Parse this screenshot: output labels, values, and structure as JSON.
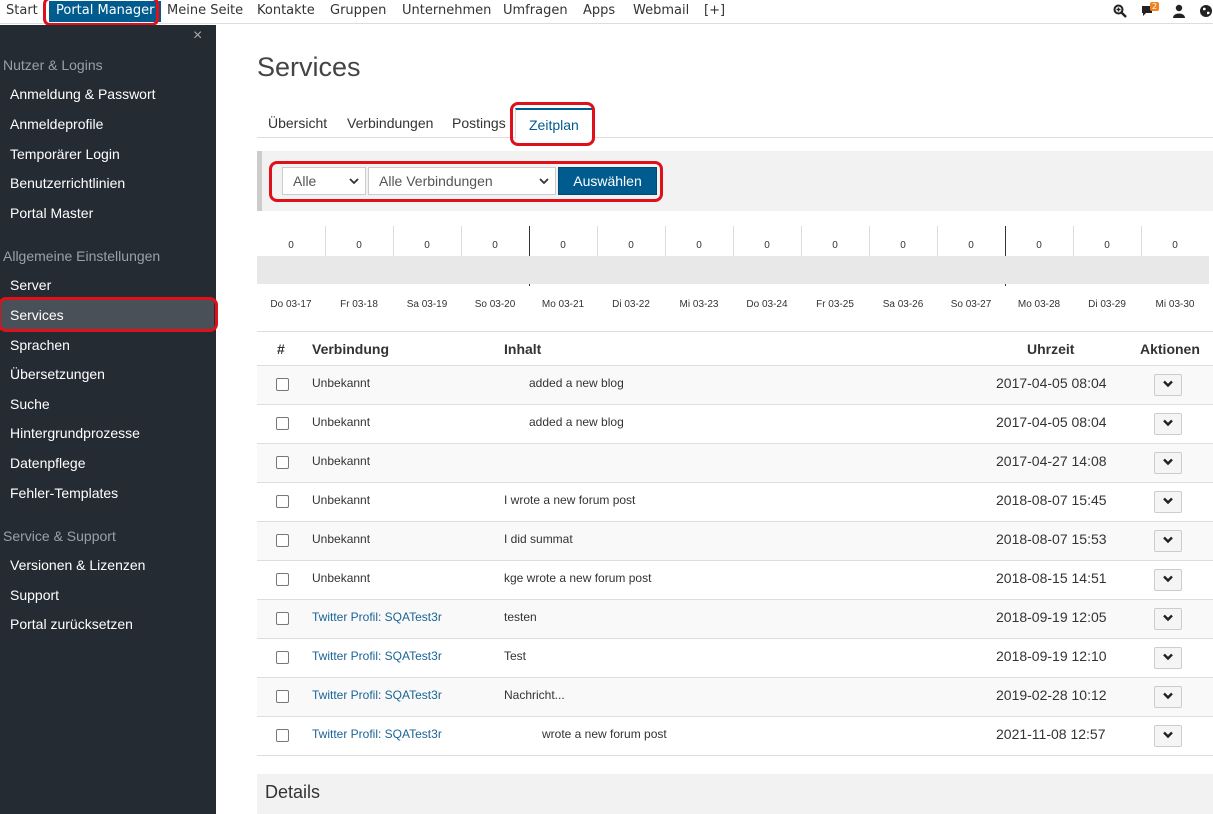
{
  "topbar": {
    "nav": [
      "Start",
      "Portal Manager",
      "Meine Seite",
      "Kontakte",
      "Gruppen",
      "Unternehmen",
      "Umfragen",
      "Apps",
      "Webmail",
      "[+]"
    ],
    "messages_badge": "2",
    "icons": [
      "search-zoom-icon",
      "messages-icon",
      "user-icon",
      "globe-icon"
    ]
  },
  "sidebar": {
    "close": "×",
    "sections": [
      {
        "title": "Nutzer & Logins",
        "items": [
          "Anmeldung & Passwort",
          "Anmeldeprofile",
          "Temporärer Login",
          "Benutzerrichtlinien",
          "Portal Master"
        ]
      },
      {
        "title": "Allgemeine Einstellungen",
        "items": [
          "Server",
          "Services",
          "Sprachen",
          "Übersetzungen",
          "Suche",
          "Hintergrundprozesse",
          "Datenpflege",
          "Fehler-Templates"
        ]
      },
      {
        "title": "Service & Support",
        "items": [
          "Versionen & Lizenzen",
          "Support",
          "Portal zurücksetzen"
        ]
      }
    ]
  },
  "page": {
    "title": "Services",
    "tabs": [
      "Übersicht",
      "Verbindungen",
      "Postings",
      "Zeitplan"
    ],
    "active_tab": "Zeitplan"
  },
  "filter": {
    "select1": "Alle",
    "select2": "Alle Verbindungen",
    "button": "Auswählen"
  },
  "timeline": {
    "days": [
      "Do 03-17",
      "Fr 03-18",
      "Sa 03-19",
      "So 03-20",
      "Mo 03-21",
      "Di 03-22",
      "Mi 03-23",
      "Do 03-24",
      "Fr 03-25",
      "Sa 03-26",
      "So 03-27",
      "Mo 03-28",
      "Di 03-29",
      "Mi 03-30"
    ],
    "counts": [
      "0",
      "0",
      "0",
      "0",
      "0",
      "0",
      "0",
      "0",
      "0",
      "0",
      "0",
      "0",
      "0",
      "0"
    ]
  },
  "table": {
    "headers": [
      "#",
      "Verbindung",
      "Inhalt",
      "Uhrzeit",
      "Aktionen"
    ],
    "rows": [
      {
        "conn": "Unbekannt",
        "content": "added a new blog",
        "time": "2017-04-05 08:04"
      },
      {
        "conn": "Unbekannt",
        "content": "added a new blog",
        "time": "2017-04-05 08:04"
      },
      {
        "conn": "Unbekannt",
        "content": "",
        "time": "2017-04-27 14:08"
      },
      {
        "conn": "Unbekannt",
        "content": "I wrote a new forum post",
        "time": "2018-08-07 15:45"
      },
      {
        "conn": "Unbekannt",
        "content": "I did summat",
        "time": "2018-08-07 15:53"
      },
      {
        "conn": "Unbekannt",
        "content": "kge wrote a new forum post",
        "time": "2018-08-15 14:51"
      },
      {
        "conn": "Twitter Profil: SQATest3r",
        "content": "testen",
        "time": "2018-09-19 12:05"
      },
      {
        "conn": "Twitter Profil: SQATest3r",
        "content": "Test",
        "time": "2018-09-19 12:10"
      },
      {
        "conn": "Twitter Profil: SQATest3r",
        "content": "Nachricht...",
        "time": "2019-02-28 10:12"
      },
      {
        "conn": "Twitter Profil: SQATest3r",
        "content": "wrote a new forum post",
        "time": "2021-11-08 12:57"
      }
    ]
  },
  "details": {
    "title": "Details"
  },
  "colors": {
    "accent": "#005c8f",
    "sidebar_bg": "#252b33",
    "highlight": "#e0101a"
  }
}
